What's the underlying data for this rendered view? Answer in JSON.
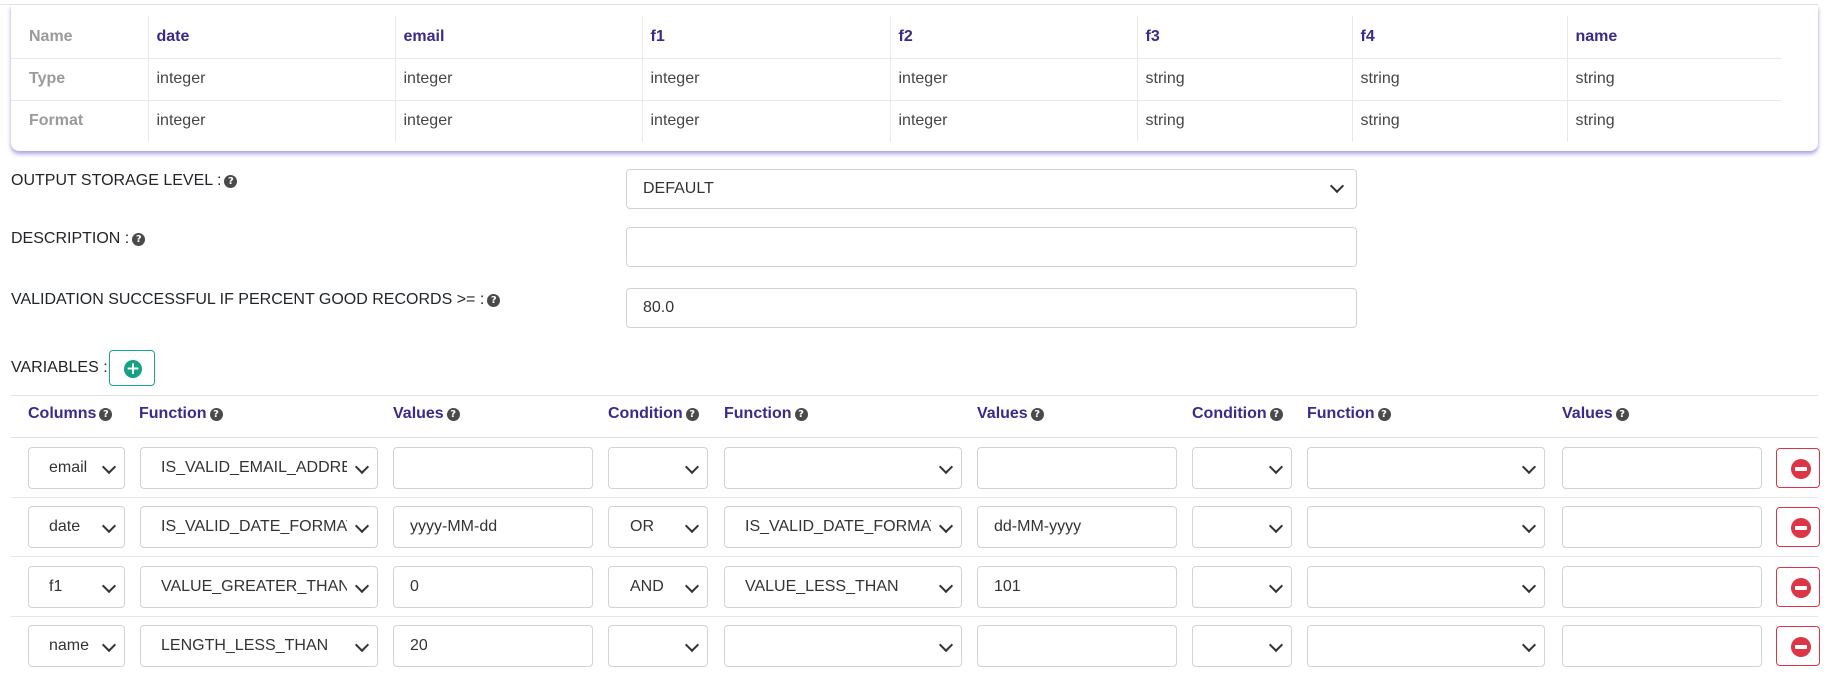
{
  "schema": {
    "row_labels": [
      "Name",
      "Type",
      "Format"
    ],
    "columns": [
      {
        "name": "date",
        "type": "integer",
        "format": "integer"
      },
      {
        "name": "email",
        "type": "integer",
        "format": "integer"
      },
      {
        "name": "f1",
        "type": "integer",
        "format": "integer"
      },
      {
        "name": "f2",
        "type": "integer",
        "format": "integer"
      },
      {
        "name": "f3",
        "type": "string",
        "format": "string"
      },
      {
        "name": "f4",
        "type": "string",
        "format": "string"
      },
      {
        "name": "name",
        "type": "string",
        "format": "string"
      }
    ]
  },
  "form": {
    "storage_level_label": "OUTPUT STORAGE LEVEL :",
    "storage_level_value": "DEFAULT",
    "description_label": "DESCRIPTION :",
    "description_value": "",
    "validation_label": "VALIDATION SUCCESSFUL IF PERCENT GOOD RECORDS >= :",
    "validation_value": "80.0",
    "variables_label": "VARIABLES :",
    "help_icon": "question-circle-icon"
  },
  "variables": {
    "headers": [
      "Columns",
      "Function",
      "Values",
      "Condition",
      "Function",
      "Values",
      "Condition",
      "Function",
      "Values"
    ],
    "rows": [
      {
        "column": "email",
        "function1": "IS_VALID_EMAIL_ADDRE",
        "value1": "",
        "condition1": "",
        "function2": "",
        "value2": "",
        "condition2": "",
        "function3": "",
        "value3": ""
      },
      {
        "column": "date",
        "function1": "IS_VALID_DATE_FORMAT",
        "value1": "yyyy-MM-dd",
        "condition1": "OR",
        "function2": "IS_VALID_DATE_FORMAT",
        "value2": "dd-MM-yyyy",
        "condition2": "",
        "function3": "",
        "value3": ""
      },
      {
        "column": "f1",
        "function1": "VALUE_GREATER_THAN",
        "value1": "0",
        "condition1": "AND",
        "function2": "VALUE_LESS_THAN",
        "value2": "101",
        "condition2": "",
        "function3": "",
        "value3": ""
      },
      {
        "column": "name",
        "function1": "LENGTH_LESS_THAN",
        "value1": "20",
        "condition1": "",
        "function2": "",
        "value2": "",
        "condition2": "",
        "function3": "",
        "value3": ""
      }
    ]
  },
  "colors": {
    "header_text": "#3b2a8a",
    "add_button": "#16a086",
    "delete_button": "#dc3545",
    "card_shadow": "#6e5ad2"
  }
}
